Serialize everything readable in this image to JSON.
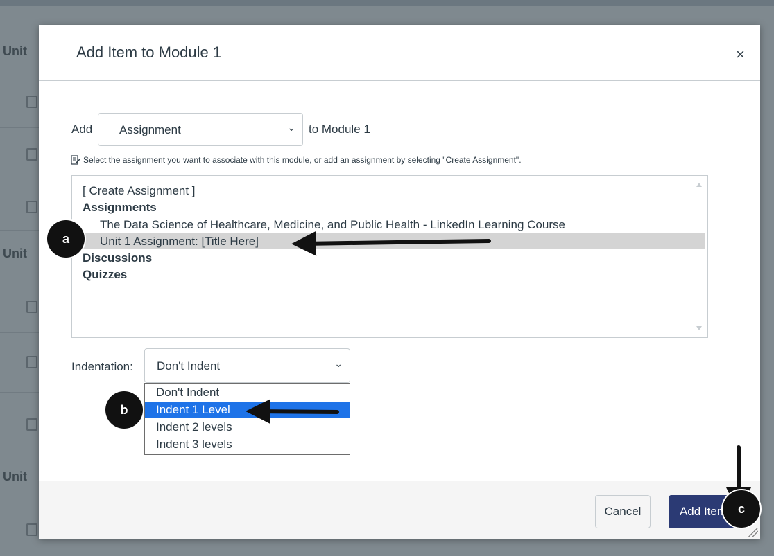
{
  "background": {
    "unit_labels": [
      "Unit",
      "Unit",
      "Unit"
    ]
  },
  "modal": {
    "title": "Add Item to Module 1",
    "close_glyph": "×",
    "add_label": "Add",
    "item_type": {
      "selected": "Assignment",
      "chevron_icon": "chevron-down-icon"
    },
    "to_module_label": "to Module 1",
    "hint": "Select the assignment you want to associate with this module, or add an assignment by selecting \"Create Assignment\".",
    "list": {
      "create": "[ Create Assignment ]",
      "group_assignments": "Assignments",
      "items": [
        "The Data Science of Healthcare, Medicine, and Public Health - LinkedIn Learning Course",
        "Unit 1 Assignment: [Title Here]"
      ],
      "selected_index": 1,
      "group_discussions": "Discussions",
      "group_quizzes": "Quizzes"
    },
    "indentation": {
      "label": "Indentation:",
      "selected": "Don't Indent",
      "options": [
        "Don't Indent",
        "Indent 1 Level",
        "Indent 2 levels",
        "Indent 3 levels"
      ],
      "highlighted_index": 1
    },
    "footer": {
      "cancel_label": "Cancel",
      "add_label": "Add Item"
    }
  },
  "annotations": {
    "a": "a",
    "b": "b",
    "c": "c"
  },
  "colors": {
    "primary_button": "#2b3a74",
    "dropdown_highlight": "#1e73e8",
    "selected_row": "#d4d4d4",
    "overlay": "#6b7780"
  }
}
